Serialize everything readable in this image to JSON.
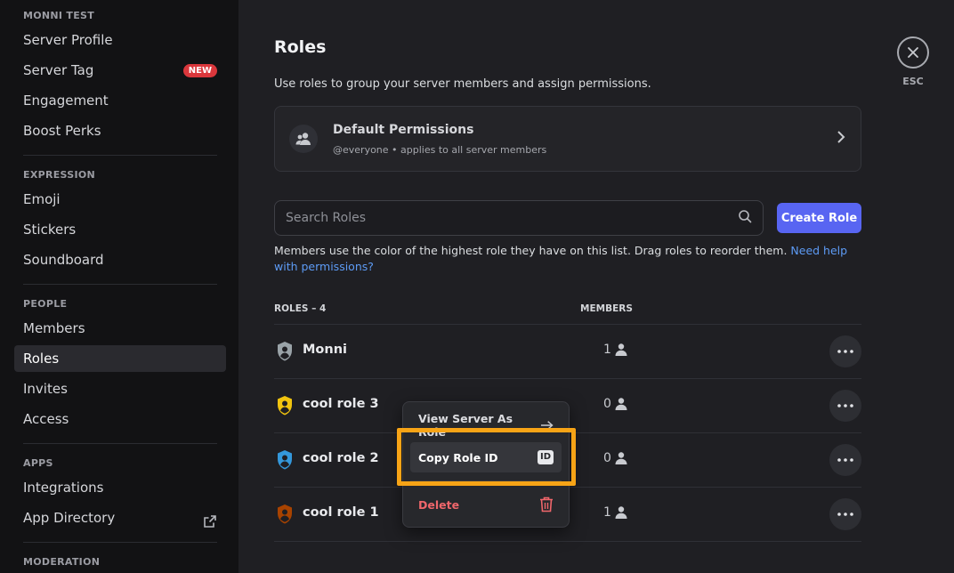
{
  "sidebar": {
    "groups": [
      {
        "label": "MONNI TEST",
        "items": [
          {
            "label": "Server Profile"
          },
          {
            "label": "Server Tag",
            "badge": "NEW"
          },
          {
            "label": "Engagement"
          },
          {
            "label": "Boost Perks"
          }
        ]
      },
      {
        "label": "EXPRESSION",
        "items": [
          {
            "label": "Emoji"
          },
          {
            "label": "Stickers"
          },
          {
            "label": "Soundboard"
          }
        ]
      },
      {
        "label": "PEOPLE",
        "items": [
          {
            "label": "Members"
          },
          {
            "label": "Roles",
            "active": true
          },
          {
            "label": "Invites"
          },
          {
            "label": "Access"
          }
        ]
      },
      {
        "label": "APPS",
        "items": [
          {
            "label": "Integrations"
          },
          {
            "label": "App Directory",
            "icon": "external-link-icon"
          }
        ]
      },
      {
        "label": "MODERATION",
        "items": []
      }
    ]
  },
  "main": {
    "title": "Roles",
    "description": "Use roles to group your server members and assign permissions.",
    "esc_label": "ESC",
    "default_permissions": {
      "title": "Default Permissions",
      "subtitle": "@everyone • applies to all server members"
    },
    "search": {
      "placeholder": "Search Roles",
      "value": ""
    },
    "create_role_label": "Create Role",
    "help_text": "Members use the color of the highest role they have on this list. Drag roles to reorder them.",
    "help_link": "Need help with permissions?",
    "roles_header": "ROLES – 4",
    "members_header": "MEMBERS",
    "roles": [
      {
        "name": "Monni",
        "members": "1",
        "color": "#9aa3a8"
      },
      {
        "name": "cool role 3",
        "members": "0",
        "color": "#f1c40f"
      },
      {
        "name": "cool role 2",
        "members": "0",
        "color": "#3498db"
      },
      {
        "name": "cool role 1",
        "members": "1",
        "color": "#a84300"
      }
    ]
  },
  "context_menu": {
    "view_label": "View Server As Role",
    "copy_label": "Copy Role ID",
    "copy_icon_text": "ID",
    "delete_label": "Delete"
  },
  "colors": {
    "accent": "#5865f2",
    "highlight": "#f7a416",
    "danger": "#f0666b",
    "badge": "#da373c"
  }
}
